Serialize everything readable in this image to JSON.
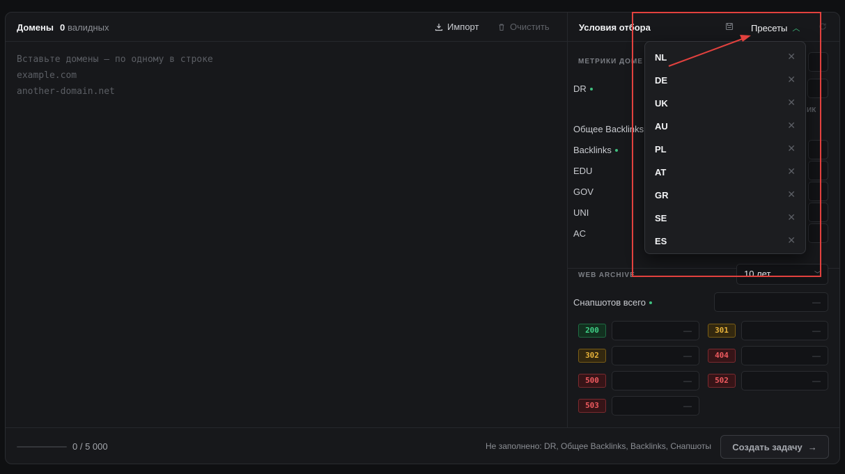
{
  "left": {
    "title": "Домены",
    "valid_count": "0",
    "valid_label": "валидных",
    "import_label": "Импорт",
    "clear_label": "Очистить",
    "placeholder_lines": [
      "Вставьте домены — по одному в строке",
      "example.com",
      "another-domain.net"
    ]
  },
  "right": {
    "title": "Условия отбора",
    "presets_label": "Пресеты",
    "metrics_section": "МЕТРИКИ ДОМЕ",
    "metrics": [
      {
        "label": "DR",
        "required": true
      },
      {
        "label": "Общее Backlinks",
        "required": false
      },
      {
        "label": "Backlinks",
        "required": true
      },
      {
        "label": "EDU",
        "required": false
      },
      {
        "label": "GOV",
        "required": false
      },
      {
        "label": "UNI",
        "required": false
      },
      {
        "label": "AC",
        "required": false
      }
    ],
    "partial_ik": "ИК",
    "archive_section": "WEB ARCHIVE",
    "archive_period": "10 лет",
    "snapshots_label": "Снапшотов всего",
    "empty_value": "—",
    "status_codes": [
      {
        "code": "200",
        "color": "green"
      },
      {
        "code": "301",
        "color": "yellow"
      },
      {
        "code": "302",
        "color": "yellow"
      },
      {
        "code": "404",
        "color": "red"
      },
      {
        "code": "500",
        "color": "red"
      },
      {
        "code": "502",
        "color": "red"
      },
      {
        "code": "503",
        "color": "red"
      }
    ]
  },
  "presets": [
    "NL",
    "DE",
    "UK",
    "AU",
    "PL",
    "AT",
    "GR",
    "SE",
    "ES"
  ],
  "footer": {
    "progress": 0,
    "progress_text": "0 / 5 000",
    "missing_text": "Не заполнено: DR, Общее Backlinks, Backlinks, Снапшоты",
    "create_label": "Создать задачу"
  },
  "colors": {
    "accent": "#3fbf7f",
    "annotation": "#e2413e"
  }
}
